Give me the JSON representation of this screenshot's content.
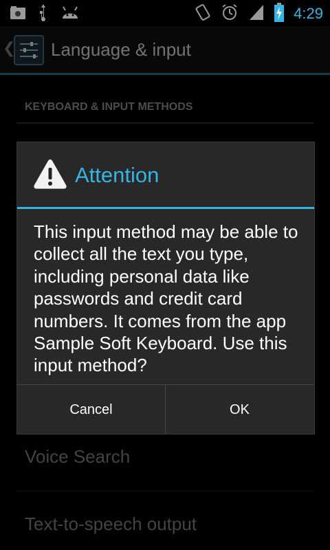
{
  "status_bar": {
    "time": "4:29",
    "icons_left": [
      "screenshot-icon",
      "usb-icon",
      "android-debug-icon"
    ],
    "icons_right": [
      "rotation-icon",
      "alarm-icon",
      "signal-icon",
      "battery-charging-icon"
    ]
  },
  "action_bar": {
    "title": "Language & input",
    "icon": "settings-icon"
  },
  "settings": {
    "section_header": "KEYBOARD & INPUT METHODS",
    "items_below": [
      "Voice Search",
      "Text-to-speech output"
    ]
  },
  "dialog": {
    "icon": "warning-icon",
    "title": "Attention",
    "message": "This input method may be able to collect all the text you type, including personal data like passwords and credit card numbers. It comes from the app Sample Soft Keyboard. Use this input method?",
    "cancel_label": "Cancel",
    "ok_label": "OK"
  },
  "colors": {
    "accent": "#33b5e5",
    "background": "#000000",
    "dialog_bg": "#282828"
  }
}
